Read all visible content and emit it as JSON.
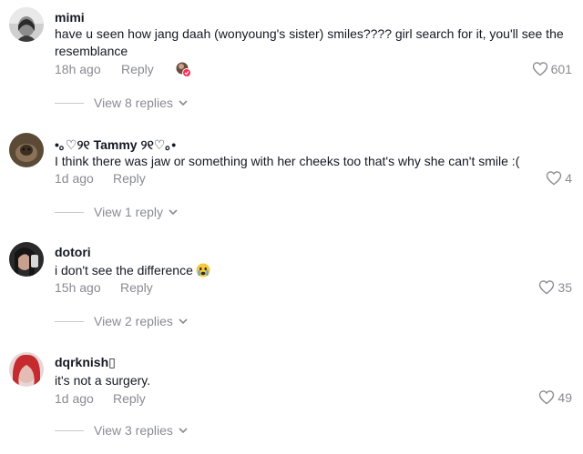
{
  "comments": [
    {
      "username": "mimi",
      "text": "have u seen how jang daah (wonyoung's sister) smiles???? girl search for it, you'll see the resemblance",
      "time": "18h ago",
      "reply_label": "Reply",
      "likes": "601",
      "view_replies": "View 8 replies",
      "avatar_icon": "avatar-photo-icon",
      "creator_liked": true
    },
    {
      "username": "•｡♡୨୧ Tammy ୨୧♡｡•",
      "text": "I think there was jaw or something with her cheeks too that's why she can't smile :(",
      "time": "1d ago",
      "reply_label": "Reply",
      "likes": "4",
      "view_replies": "View 1 reply",
      "avatar_icon": "avatar-photo-icon"
    },
    {
      "username": "dotori",
      "text": "i don't see the difference",
      "text_emoji": "crying-face-emoji",
      "time": "15h ago",
      "reply_label": "Reply",
      "likes": "35",
      "view_replies": "View 2 replies",
      "avatar_icon": "avatar-photo-icon"
    },
    {
      "username": "dqrknish",
      "username_suffix": "▯",
      "text": "it's not a surgery.",
      "time": "1d ago",
      "reply_label": "Reply",
      "likes": "49",
      "view_replies": "View 3 replies",
      "avatar_icon": "avatar-photo-icon"
    }
  ],
  "icons": {
    "like": "heart-outline-icon",
    "expand": "chevron-down-icon"
  },
  "colors": {
    "primary_text": "#161823",
    "secondary_text": "#8a8b91",
    "divider": "#c8c9cc"
  }
}
